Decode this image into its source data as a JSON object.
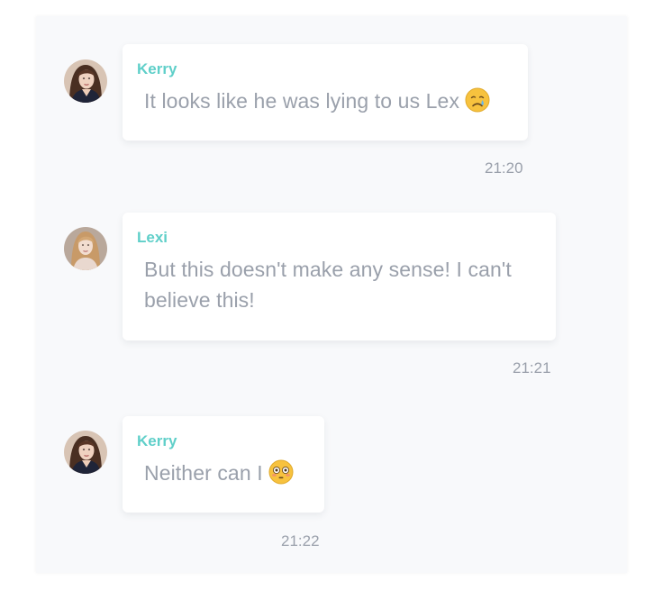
{
  "messages": [
    {
      "sender": "Kerry",
      "text": "It looks like he was lying to us Lex",
      "emoji": "crying-face-emoji",
      "time": "21:20"
    },
    {
      "sender": "Lexi",
      "text": "But this doesn't make any sense! I can't believe this!",
      "time": "21:21"
    },
    {
      "sender": "Kerry",
      "text": "Neither can I",
      "emoji": "flushed-face-emoji",
      "time": "21:22"
    }
  ],
  "colors": {
    "sender_name": "#5fcfc9",
    "message_text": "#9aa0ab",
    "panel_background": "#f8f9fb",
    "bubble_background": "#ffffff"
  }
}
